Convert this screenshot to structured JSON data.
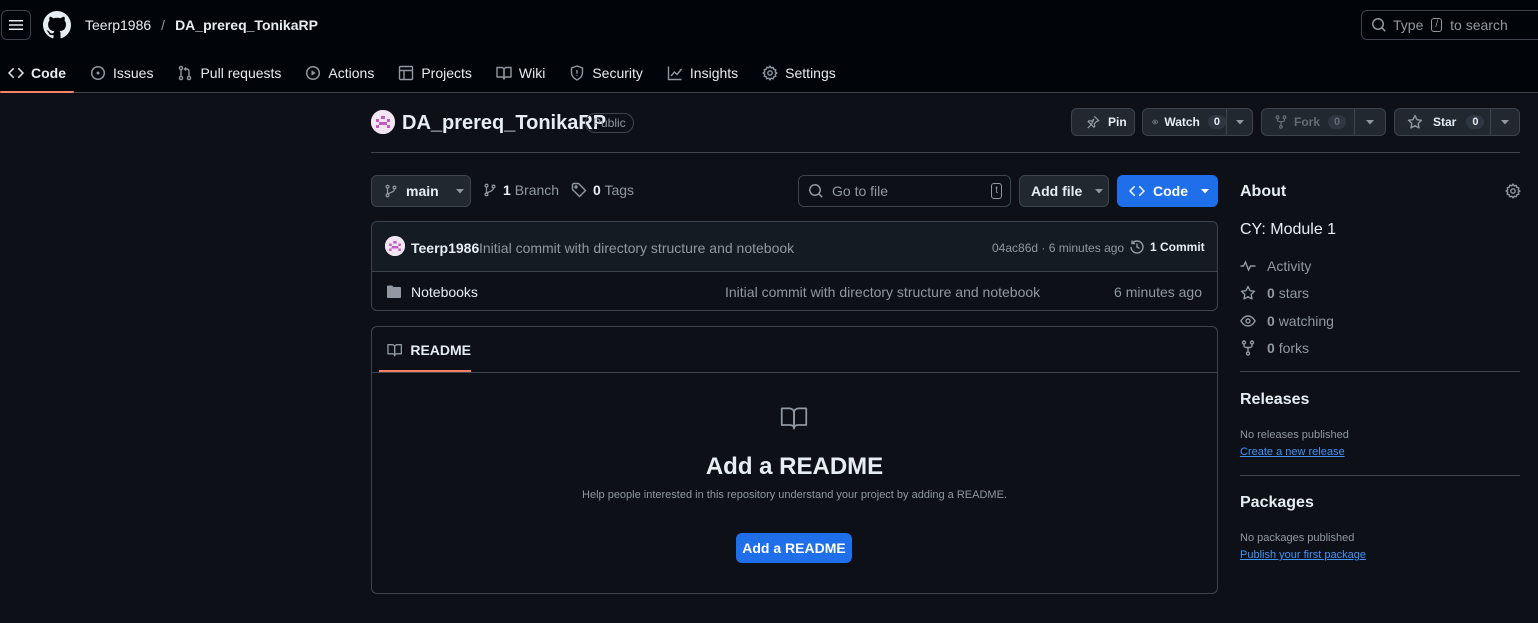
{
  "header": {
    "owner": "Teerp1986",
    "separator": "/",
    "repo": "DA_prereq_TonikaRP",
    "search_prefix": "Type",
    "search_key": "/",
    "search_suffix": "to search"
  },
  "tabs": [
    {
      "label": "Code",
      "icon": "code-icon",
      "active": true
    },
    {
      "label": "Issues",
      "icon": "issue-icon"
    },
    {
      "label": "Pull requests",
      "icon": "pull-request-icon"
    },
    {
      "label": "Actions",
      "icon": "play-icon"
    },
    {
      "label": "Projects",
      "icon": "table-icon"
    },
    {
      "label": "Wiki",
      "icon": "book-icon"
    },
    {
      "label": "Security",
      "icon": "shield-icon"
    },
    {
      "label": "Insights",
      "icon": "graph-icon"
    },
    {
      "label": "Settings",
      "icon": "gear-icon"
    }
  ],
  "repo_header": {
    "name": "DA_prereq_TonikaRP",
    "visibility": "Public",
    "pin_label": "Pin",
    "watch_label": "Watch",
    "watch_count": "0",
    "fork_label": "Fork",
    "fork_count": "0",
    "star_label": "Star",
    "star_count": "0"
  },
  "toolbar": {
    "branch": "main",
    "branch_count": "1",
    "branch_label": "Branch",
    "tag_count": "0",
    "tag_label": "Tags",
    "goto_placeholder": "Go to file",
    "goto_key": "t",
    "add_file_label": "Add file",
    "code_label": "Code"
  },
  "commit": {
    "author": "Teerp1986",
    "message": "Initial commit with directory structure and notebook",
    "sha_time": "04ac86d · 6 minutes ago",
    "commit_count": "1 Commit"
  },
  "files": [
    {
      "name": "Notebooks",
      "message": "Initial commit with directory structure and notebook",
      "age": "6 minutes ago"
    }
  ],
  "readme": {
    "tab_label": "README",
    "heading": "Add a README",
    "help": "Help people interested in this repository understand your project by adding a README.",
    "button": "Add a README"
  },
  "about": {
    "title": "About",
    "description": "CY: Module 1",
    "activity": "Activity",
    "stars_count": "0",
    "stars_label": "stars",
    "watching_count": "0",
    "watching_label": "watching",
    "forks_count": "0",
    "forks_label": "forks",
    "releases_title": "Releases",
    "releases_none": "No releases published",
    "releases_link": "Create a new release",
    "packages_title": "Packages",
    "packages_none": "No packages published",
    "packages_link": "Publish your first package"
  },
  "colors": {
    "background": "#0d1117",
    "header": "#010409",
    "border": "#3d444d",
    "accent": "#1f6feb",
    "tab_underline": "#f78166",
    "link": "#4493f8"
  }
}
